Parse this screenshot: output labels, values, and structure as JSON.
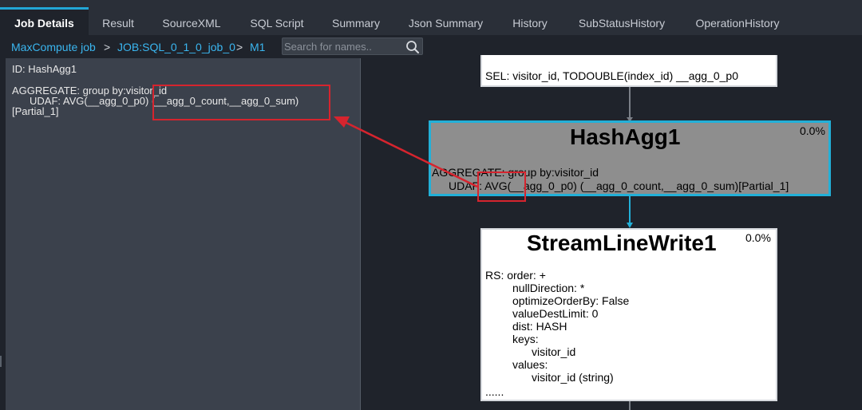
{
  "tabs": [
    "Job Details",
    "Result",
    "SourceXML",
    "SQL Script",
    "Summary",
    "Json Summary",
    "History",
    "SubStatusHistory",
    "OperationHistory"
  ],
  "active_tab": "Job Details",
  "breadcrumb": {
    "items": [
      "MaxCompute job",
      "JOB:SQL_0_1_0_job_0",
      "M1"
    ],
    "separator": ">"
  },
  "search": {
    "placeholder": "Search for names..",
    "value": ""
  },
  "detail": {
    "id_line": "ID: HashAgg1",
    "line1": "AGGREGATE: group by:visitor_id",
    "line2": "UDAF: AVG(__agg_0_p0) (__agg_0_count,__agg_0_sum)",
    "line3": "[Partial_1]"
  },
  "graph": {
    "sel_node": {
      "text": "SEL: visitor_id, TODOUBLE(index_id) __agg_0_p0"
    },
    "hashagg_node": {
      "title": "HashAgg1",
      "percent": "0.0%",
      "line1": "AGGREGATE: group by:visitor_id",
      "line2": "UDAF: AVG(__agg_0_p0) (__agg_0_count,__agg_0_sum)[Partial_1]"
    },
    "write_node": {
      "title": "StreamLineWrite1",
      "percent": "0.0%",
      "lines": [
        "RS: order: +",
        "nullDirection: *",
        "optimizeOrderBy: False",
        "valueDestLimit: 0",
        "dist: HASH",
        "keys:",
        "visitor_id",
        "values:",
        "visitor_id (string)",
        "......"
      ]
    }
  },
  "colors": {
    "accent": "#22a6d6",
    "link": "#3ab6f0",
    "annotation": "#d6242e",
    "panel_bg": "#3b414c",
    "app_bg": "#1f232b"
  }
}
